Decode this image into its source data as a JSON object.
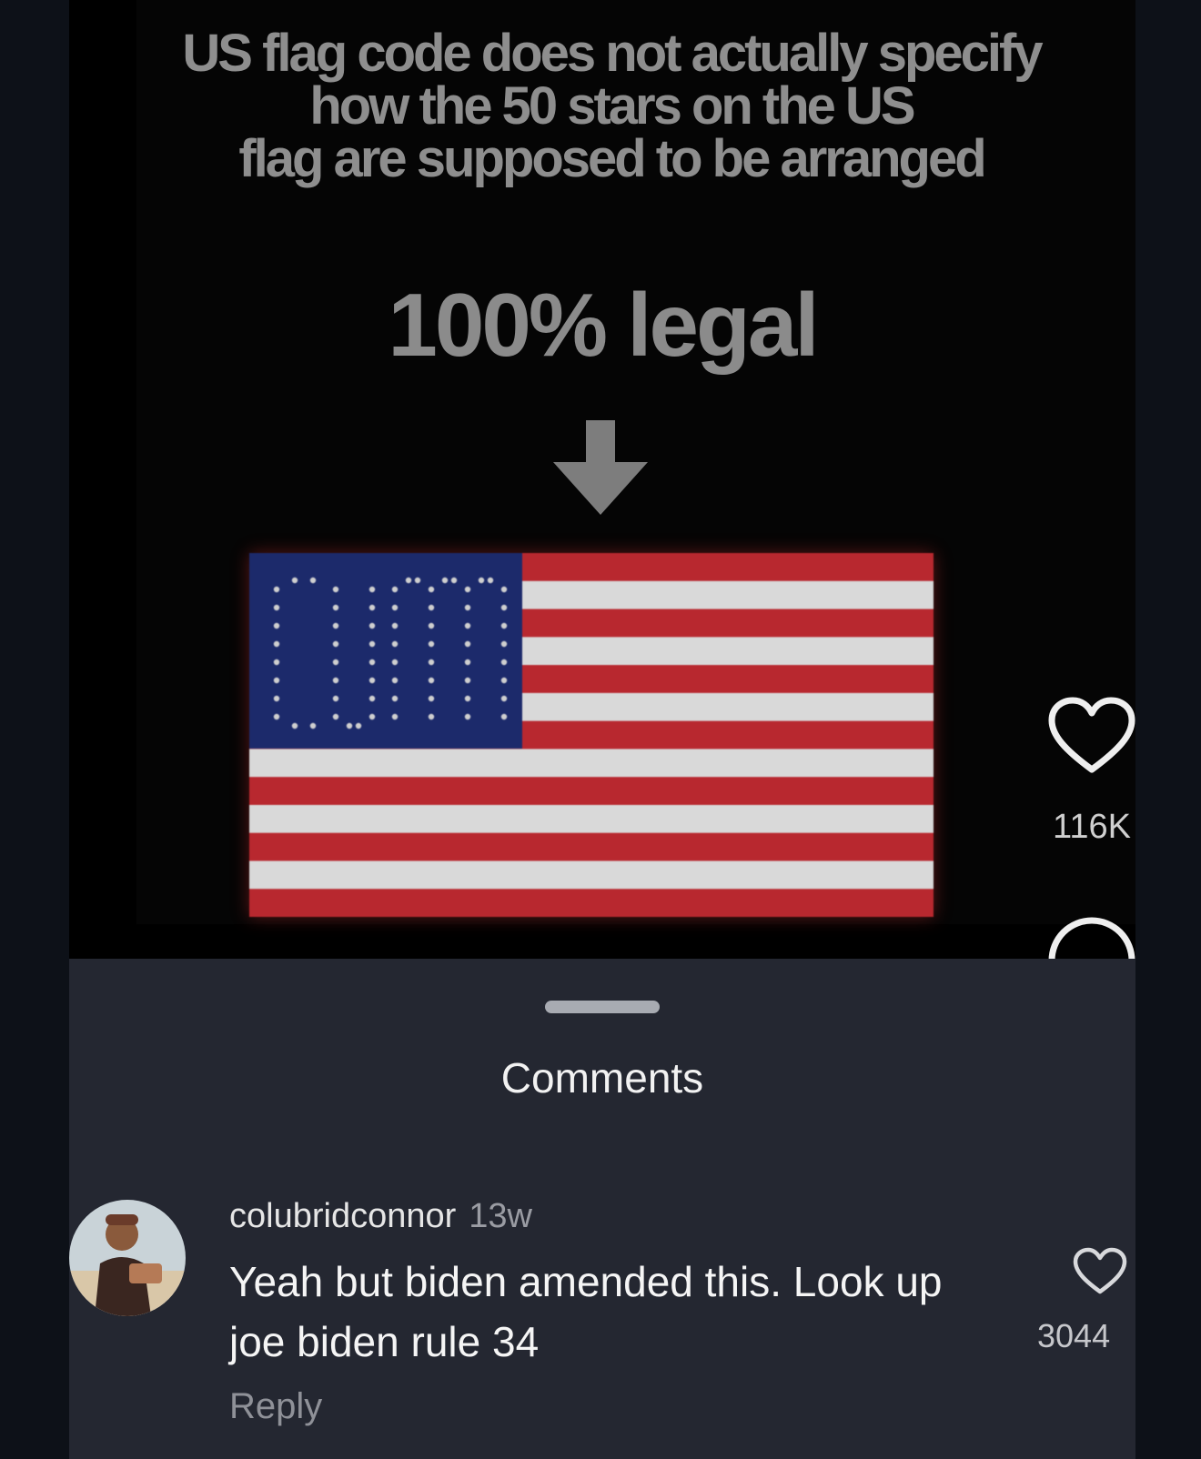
{
  "video": {
    "headline": "US flag code does not actually specify\nhow the 50 stars on the US\nflag are supposed to be arranged",
    "caption": "100% legal",
    "arrow_icon": "arrow-down-icon",
    "flag_icon": "us-flag-image"
  },
  "actions": {
    "like_icon": "heart-outline-icon",
    "like_count": "116K",
    "comment_icon": "comment-bubble-icon"
  },
  "comments_sheet": {
    "title": "Comments",
    "comments": [
      {
        "username": "colubridconnor",
        "time": "13w",
        "text": "Yeah but biden amended this. Look up joe biden rule 34",
        "reply_label": "Reply",
        "like_icon": "heart-outline-icon",
        "like_count": "3044"
      }
    ]
  },
  "colors": {
    "background": "#000000",
    "sheet": "#242731",
    "flag_red": "#b8282f",
    "flag_white": "#d9d9d9",
    "flag_blue": "#1c2a6b"
  }
}
